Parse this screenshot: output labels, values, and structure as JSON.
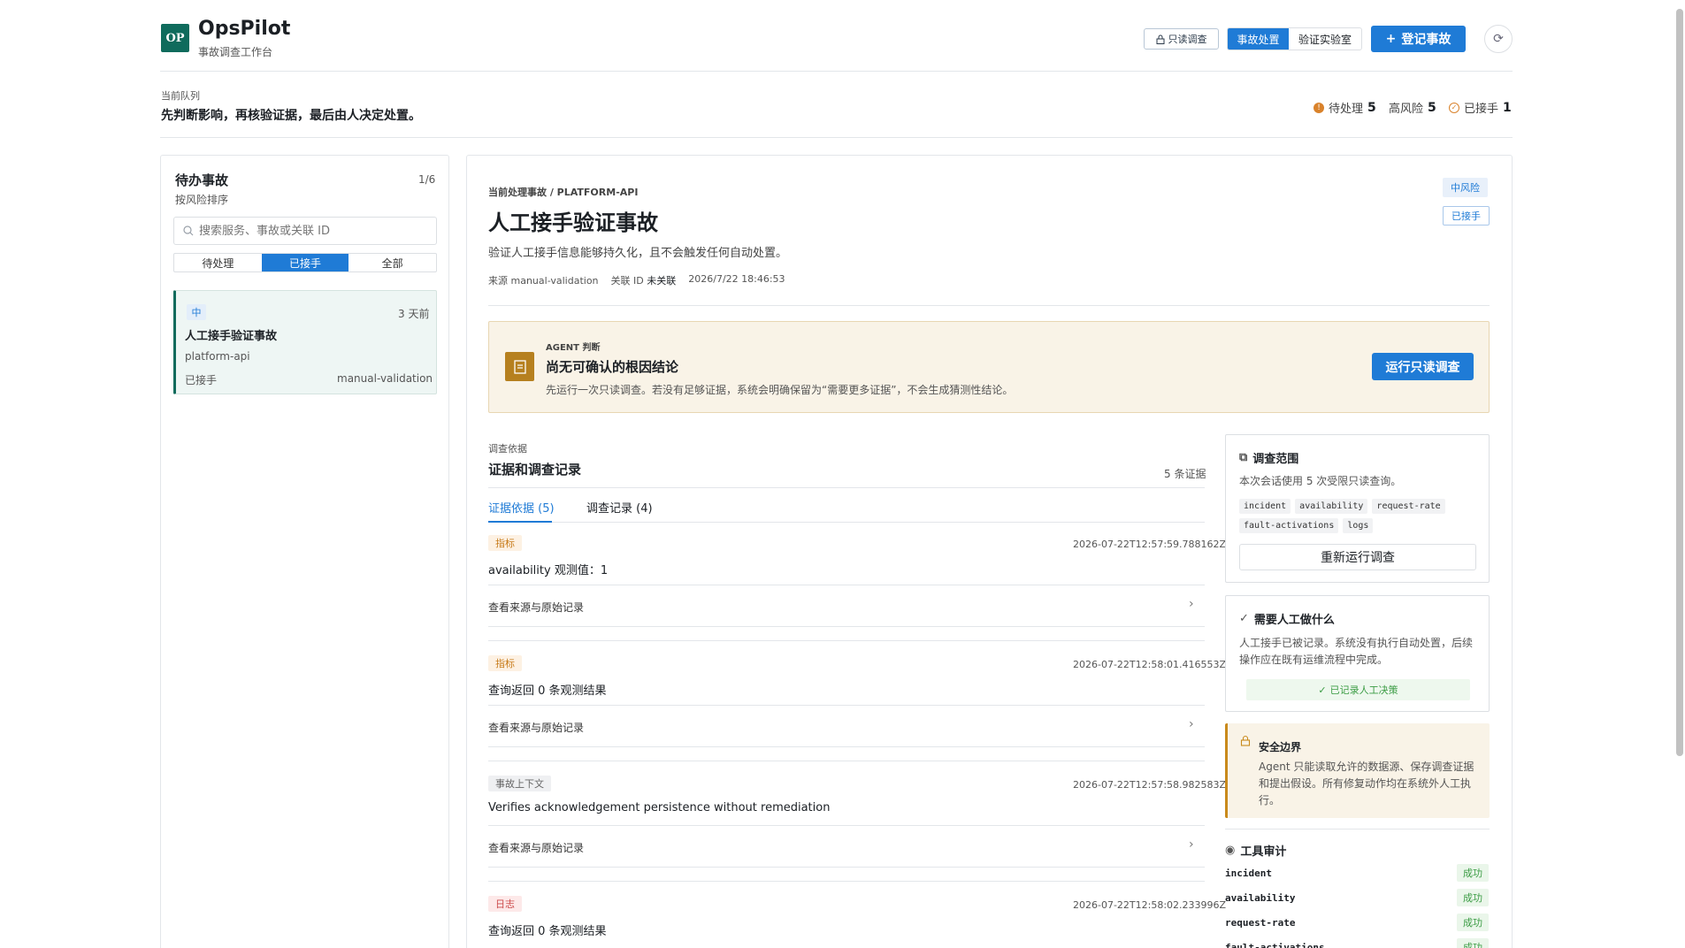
{
  "app": {
    "logo": "OP",
    "title": "OpsPilot",
    "subtitle": "事故调查工作台"
  },
  "header": {
    "readonly_label": "只读调查",
    "seg_incident": "事故处置",
    "seg_lab": "验证实验室",
    "register_label": "登记事故"
  },
  "queue": {
    "label": "当前队列",
    "text": "先判断影响，再核验证据，最后由人决定处置。",
    "stats": {
      "pending_label": "待处理",
      "pending_value": "5",
      "high_label": "高风险",
      "high_value": "5",
      "acked_label": "已接手",
      "acked_value": "1"
    }
  },
  "sidebar": {
    "title": "待办事故",
    "count": "1/6",
    "subtitle": "按风险排序",
    "search_placeholder": "搜索服务、事故或关联 ID",
    "filters": [
      "待处理",
      "已接手",
      "全部"
    ],
    "card": {
      "severity": "中",
      "time": "3 天前",
      "title": "人工接手验证事故",
      "service": "platform-api",
      "state": "已接手",
      "source": "manual-validation"
    }
  },
  "incident": {
    "breadcrumb": "当前处理事故 / PLATFORM-API",
    "title": "人工接手验证事故",
    "description": "验证人工接手信息能够持久化，且不会触发任何自动处置。",
    "source_label": "来源",
    "source_value": "manual-validation",
    "ref_label": "关联 ID",
    "ref_value": "未关联",
    "timestamp": "2026/7/22 18:46:53",
    "risk_tag": "中风险",
    "ack_tag": "已接手"
  },
  "agent": {
    "label": "AGENT 判断",
    "title": "尚无可确认的根因结论",
    "description": "先运行一次只读调查。若没有足够证据，系统会明确保留为“需要更多证据”，不会生成猜测性结论。",
    "run_label": "运行只读调查"
  },
  "evidence": {
    "label": "调查依据",
    "title": "证据和调查记录",
    "count": "5 条证据",
    "tab_evidence": "证据依据 (5)",
    "tab_records": "调查记录 (4)",
    "link_label": "查看来源与原始记录",
    "items": [
      {
        "badge": "指标",
        "ts": "2026-07-22T12:57:59.788162Z",
        "text": "availability 观测值：1"
      },
      {
        "badge": "指标",
        "ts": "2026-07-22T12:58:01.416553Z",
        "text": "查询返回 0 条观测结果"
      },
      {
        "badge": "事故上下文",
        "ts": "2026-07-22T12:57:58.982583Z",
        "text": "Verifies acknowledgement persistence without remediation"
      },
      {
        "badge": "日志",
        "ts": "2026-07-22T12:58:02.233996Z",
        "text": "查询返回 0 条观测结果"
      }
    ]
  },
  "scope": {
    "title": "调查范围",
    "text": "本次会话使用 5 次受限只读查询。",
    "chips": [
      "incident",
      "availability",
      "request-rate",
      "fault-activations",
      "logs"
    ],
    "rerun_label": "重新运行调查"
  },
  "human": {
    "title": "需要人工做什么",
    "text": "人工接手已被记录。系统没有执行自动处置，后续操作应在既有运维流程中完成。",
    "recorded_label": "已记录人工决策"
  },
  "safety": {
    "title": "安全边界",
    "text": "Agent 只能读取允许的数据源、保存调查证据和提出假设。所有修复动作均在系统外人工执行。"
  },
  "audit": {
    "title": "工具审计",
    "rows": [
      {
        "name": "incident",
        "status": "成功"
      },
      {
        "name": "availability",
        "status": "成功"
      },
      {
        "name": "request-rate",
        "status": "成功"
      },
      {
        "name": "fault-activations",
        "status": "成功"
      }
    ]
  }
}
